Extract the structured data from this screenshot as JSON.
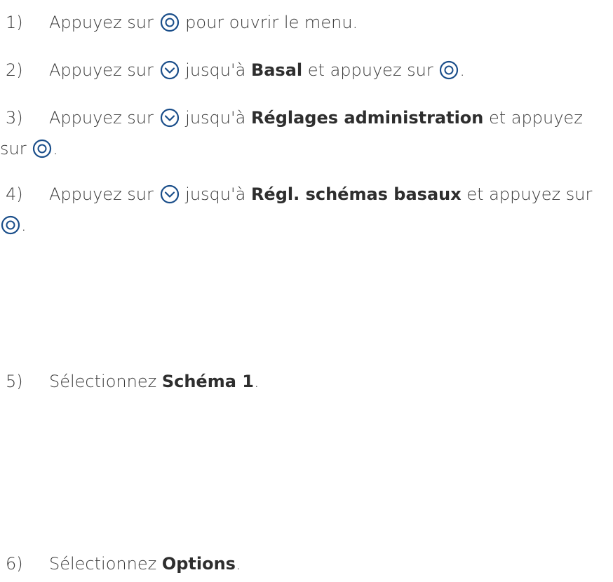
{
  "icons": {
    "ok": "ok-button-icon",
    "down": "down-arrow-button-icon",
    "color": "#1a4e8a"
  },
  "steps": [
    {
      "num": "1)",
      "pre": "Appuyez sur",
      "post": "pour ouvrir le menu."
    },
    {
      "num": "2)",
      "pre": "Appuyez sur",
      "mid": "jusqu'à",
      "bold": "Basal",
      "after": "et appuyez sur",
      "end": "."
    },
    {
      "num": "3)",
      "pre": "Appuyez sur",
      "mid": "jusqu'à",
      "bold": "Réglages administration",
      "after": "et appuyez",
      "line2": "sur",
      "end": "."
    },
    {
      "num": "4)",
      "pre": "Appuyez sur",
      "mid": "jusqu'à",
      "bold": "Régl. schémas basaux",
      "after": "et appuyez sur",
      "end": "."
    },
    {
      "num": "5)",
      "pre": "Sélectionnez",
      "bold": "Schéma 1",
      "end": "."
    },
    {
      "num": "6)",
      "pre": "Sélectionnez",
      "bold": "Options",
      "end": "."
    }
  ]
}
